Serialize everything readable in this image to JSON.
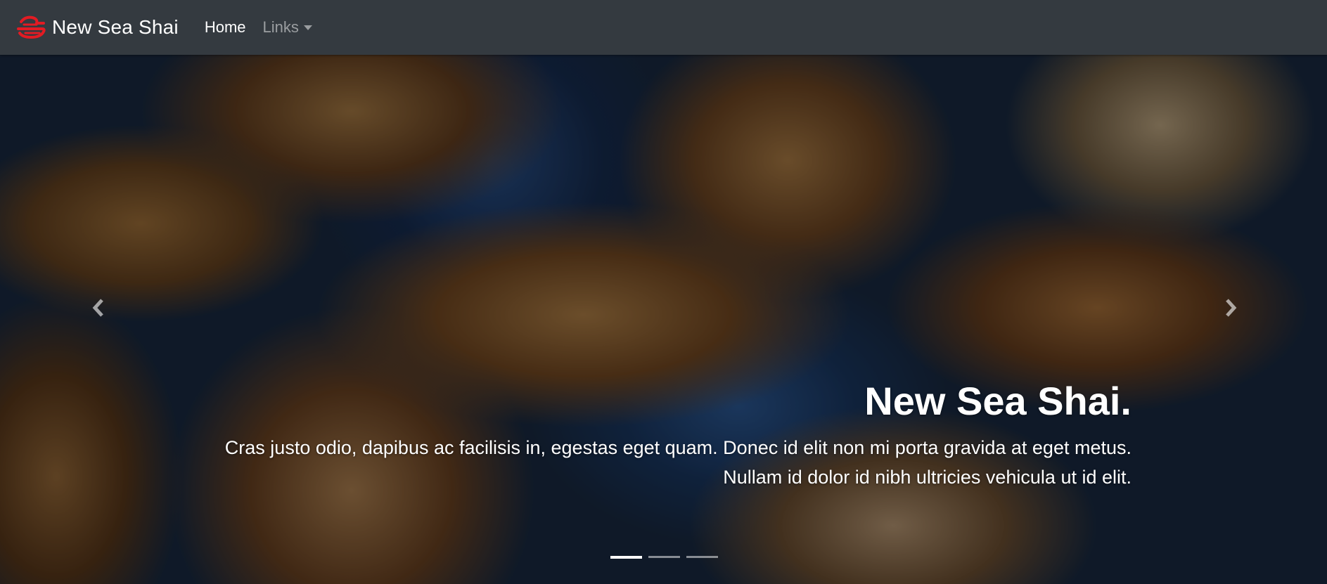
{
  "navbar": {
    "brand_name": "New Sea Shai",
    "logo_icon": "shai-logo-icon",
    "logo_color": "#e31b23",
    "links": [
      {
        "label": "Home",
        "active": true
      },
      {
        "label": "Links",
        "dropdown": true
      }
    ]
  },
  "carousel": {
    "slide": {
      "title": "New Sea Shai.",
      "text": "Cras justo odio, dapibus ac facilisis in, egestas eget quam. Donec id elit non mi porta gravida at eget metus. Nullam id dolor id nibh ultricies vehicula ut id elit."
    },
    "prev_icon": "chevron-left-icon",
    "next_icon": "chevron-right-icon",
    "indicator_count": 3,
    "active_index": 0
  }
}
